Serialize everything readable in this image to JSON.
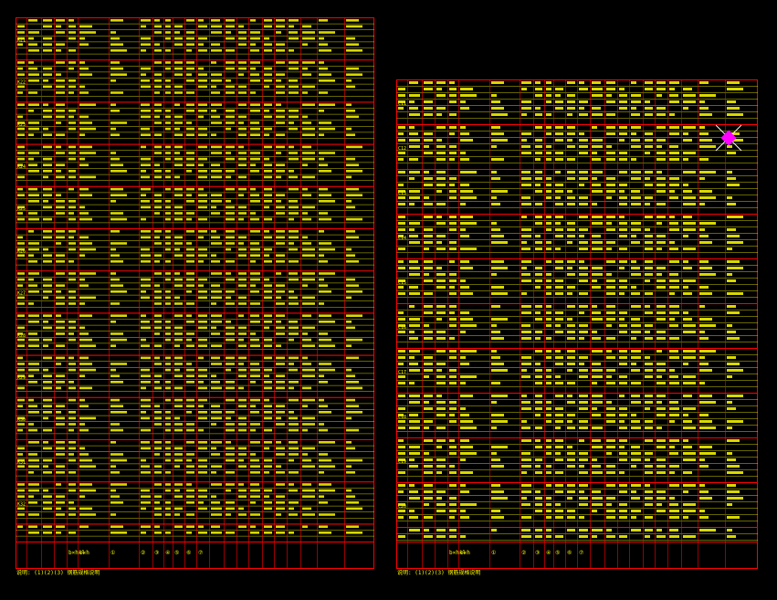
{
  "colors": {
    "background": "#000000",
    "grid_line": "#ff0000",
    "text": "#ffff00",
    "accent_magenta": "#ff00ff",
    "accent_white": "#ffffff"
  },
  "left_sheet": {
    "row_groups": [
      "K21",
      "K22",
      "K23",
      "K24",
      "K25",
      "K26",
      "K27",
      "K28",
      "K29",
      "K30",
      "K31",
      "K32",
      "K33",
      "K34"
    ],
    "header_labels": [
      "b×h×l",
      "b×h",
      "①",
      "②",
      "③",
      "④",
      "⑤",
      "⑥",
      "⑦"
    ],
    "note": "说明: (1)(2)(3) 钢筋规格说明"
  },
  "right_sheet": {
    "row_groups": [
      "C11",
      "C12",
      "C13",
      "C14",
      "C15",
      "C16",
      "C17",
      "C18",
      "C19",
      "C20",
      "C21",
      "C22"
    ],
    "header_labels": [
      "b×h×l",
      "b×h",
      "①",
      "②",
      "③",
      "④",
      "⑤",
      "⑥",
      "⑦"
    ],
    "note": "说明: (1)(2)(3) 钢筋规格说明"
  }
}
